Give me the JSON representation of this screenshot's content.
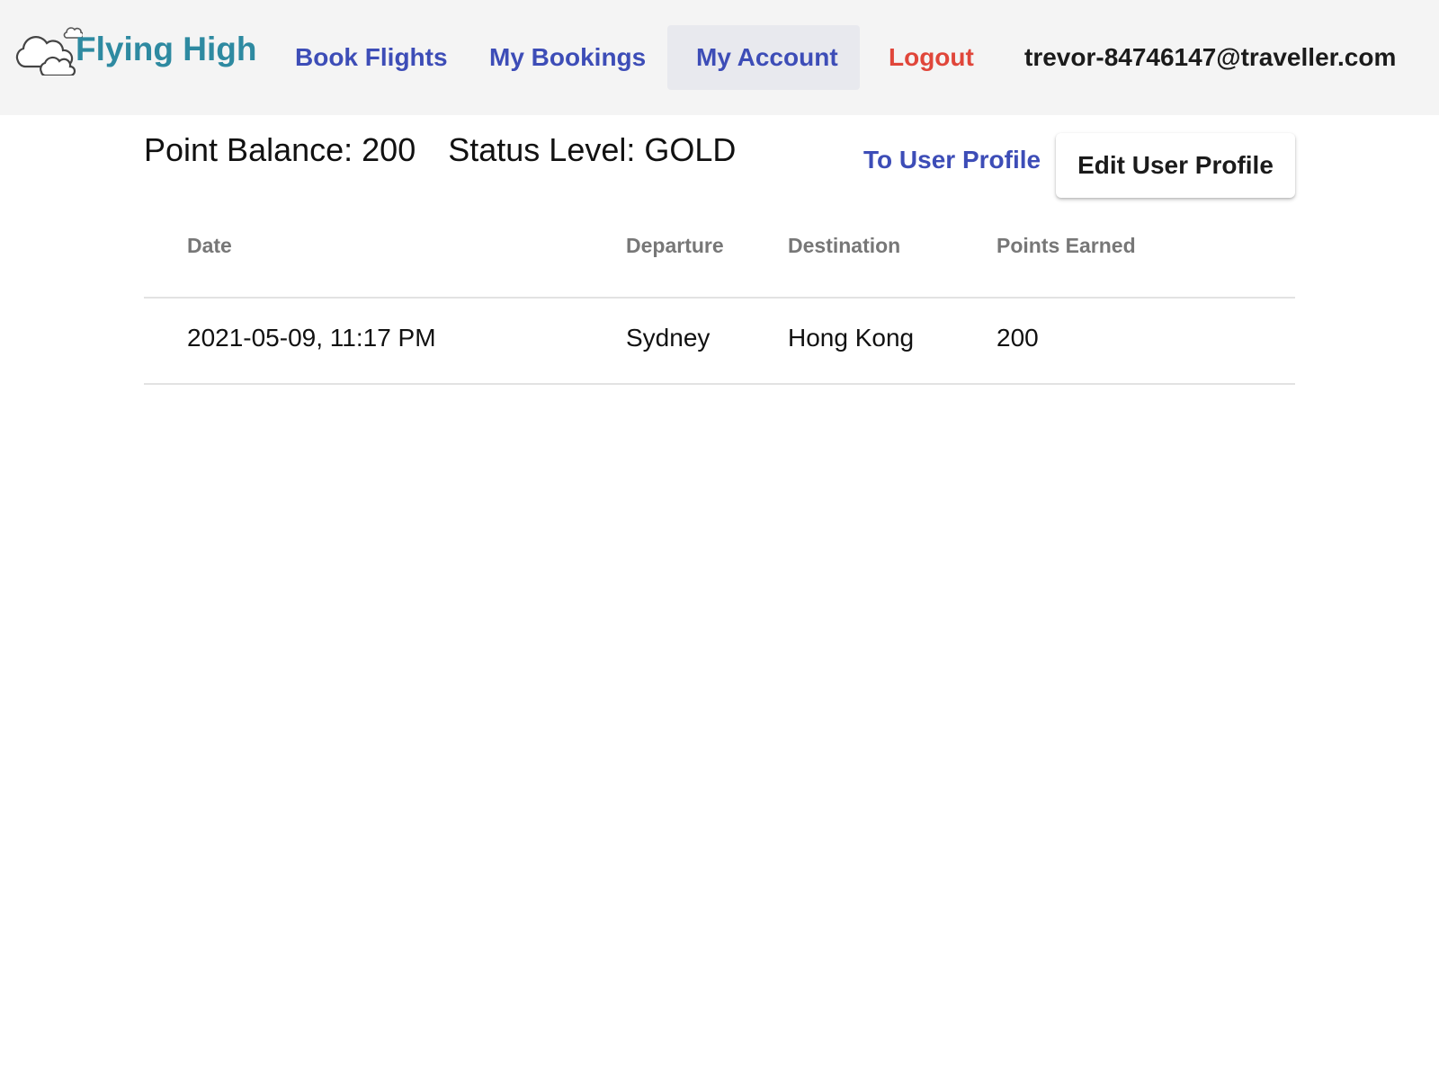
{
  "header": {
    "brand": "Flying High",
    "nav": {
      "book_flights": "Book Flights",
      "my_bookings": "My Bookings",
      "my_account": "My Account",
      "logout": "Logout"
    },
    "user_email": "trevor-84746147@traveller.com",
    "colors": {
      "bar_background": "#f4f4f4",
      "brand": "#2e8aa1",
      "nav_link": "#3d4db7",
      "logout": "#e0463a",
      "active_tab_background": "#e8e9ee"
    }
  },
  "account": {
    "point_balance": "Point Balance: 200",
    "status_level": "Status Level: GOLD",
    "to_user_profile": "To User Profile",
    "edit_user_profile": "Edit User Profile"
  },
  "table": {
    "columns": [
      "Date",
      "Departure",
      "Destination",
      "Points Earned"
    ],
    "rows": [
      [
        "2021-05-09, 11:17 PM",
        "Sydney",
        "Hong Kong",
        "200"
      ]
    ]
  }
}
